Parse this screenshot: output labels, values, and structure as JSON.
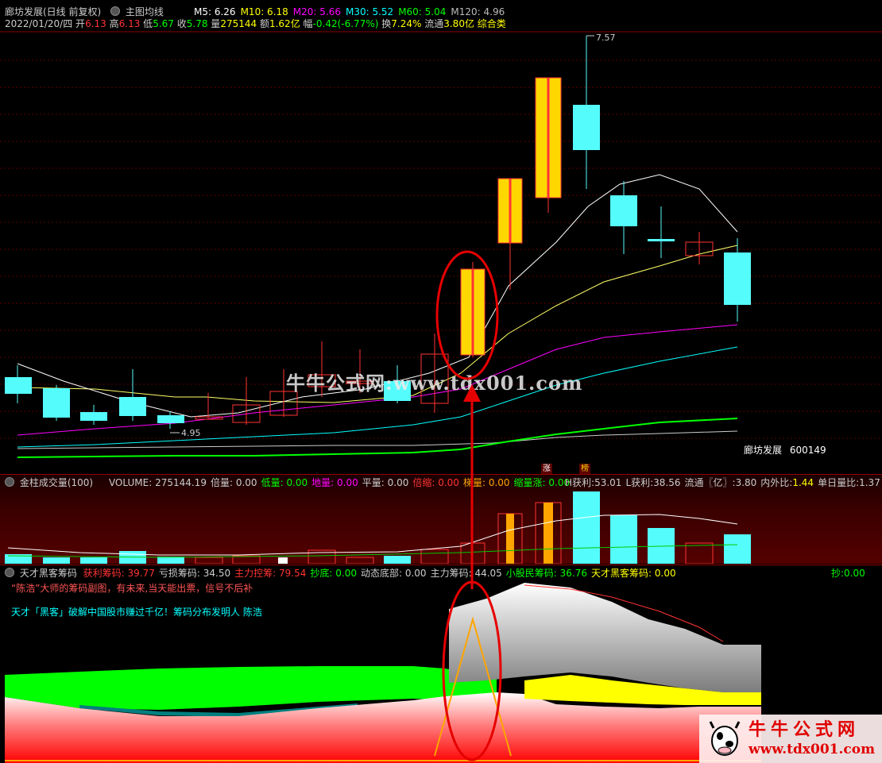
{
  "main": {
    "title": "廊坊发展(日线 前复权)",
    "indicator": "主图均线",
    "ma": [
      {
        "label": "M5: 6.26",
        "color": "#ffffff"
      },
      {
        "label": "M10: 6.18",
        "color": "#ffff00"
      },
      {
        "label": "M20: 5.66",
        "color": "#ff00ff"
      },
      {
        "label": "M30: 5.52",
        "color": "#00ffff"
      },
      {
        "label": "M60: 5.04",
        "color": "#00ff00"
      },
      {
        "label": "M120: 4.96",
        "color": "#bbbbbb"
      }
    ],
    "info": {
      "date": "2022/01/20/四",
      "open_lbl": "开",
      "open": "6.13",
      "high_lbl": "高",
      "high": "6.13",
      "low_lbl": "低",
      "low": "5.67",
      "close_lbl": "收",
      "close": "5.78",
      "vol_lbl": "量",
      "vol": "275144",
      "amt_lbl": "额",
      "amt": "1.62亿",
      "chg_lbl": "幅",
      "chg": "-0.42(-6.77%)",
      "turn_lbl": "换",
      "turn": "7.24%",
      "float_lbl": "流通",
      "float": "3.80亿",
      "cat": "综合类"
    },
    "high_marker": "7.57",
    "low_marker": "4.95",
    "stock_name": "廊坊发展",
    "stock_code": "600149",
    "badge_zhang": "涨",
    "badge_bang": "榜",
    "watermark": "牛牛公式网:www.tdx001.com"
  },
  "volume": {
    "title": "金柱成交量(100)",
    "items": [
      {
        "label": "VOLUME:",
        "value": "275144.19",
        "color": "#cccccc"
      },
      {
        "label": "倍量:",
        "value": "0.00",
        "color": "#cccccc"
      },
      {
        "label": "低量:",
        "value": "0.00",
        "color": "#00ff00"
      },
      {
        "label": "地量:",
        "value": "0.00",
        "color": "#ff00ff"
      },
      {
        "label": "平量:",
        "value": "0.00",
        "color": "#cccccc"
      },
      {
        "label": "倍缩:",
        "value": "0.00",
        "color": "#ff3333"
      },
      {
        "label": "梯量:",
        "value": "0.00",
        "color": "#ffa500"
      },
      {
        "label": "缩量涨:",
        "value": "0.00",
        "color": "#00ff00"
      }
    ],
    "right": [
      {
        "label": "H获利:",
        "value": "53.01"
      },
      {
        "label": "L获利:",
        "value": "38.56"
      },
      {
        "label": "流通〖亿〗:",
        "value": "3.80"
      },
      {
        "label": "内外比:",
        "value": "1.44"
      },
      {
        "label": "单日量比:",
        "value": "1.37"
      }
    ]
  },
  "chip": {
    "title": "天才黑客筹码",
    "items": [
      {
        "label": "获利筹码:",
        "value": "39.77",
        "color": "#ff3333"
      },
      {
        "label": "亏损筹码:",
        "value": "34.50",
        "color": "#cccccc"
      },
      {
        "label": "主力控筹:",
        "value": "79.54",
        "color": "#ff3333"
      },
      {
        "label": "抄底:",
        "value": "0.00",
        "color": "#00ff00"
      },
      {
        "label": "动态底部:",
        "value": "0.00",
        "color": "#cccccc"
      },
      {
        "label": "主力筹码:",
        "value": "44.05",
        "color": "#cccccc"
      },
      {
        "label": "小股民筹码:",
        "value": "36.76",
        "color": "#00ff00"
      },
      {
        "label": "天才黑客筹码:",
        "value": "0.00",
        "color": "#ffff00"
      }
    ],
    "right_label": "抄:",
    "right_value": "0.00",
    "note1": "“陈浩”大师的筹码副图，有未来,当天能出票，信号不后补",
    "note2": "天才「黑客」破解中国股市赚过千亿！筹码分布发明人 陈浩"
  },
  "logo": {
    "title": "牛牛公式网",
    "url": "www.tdx001.com"
  },
  "colors": {
    "up": "#ff3333",
    "down": "#54fcfc",
    "gold": "#ffd700",
    "annotation": "#e60000"
  }
}
